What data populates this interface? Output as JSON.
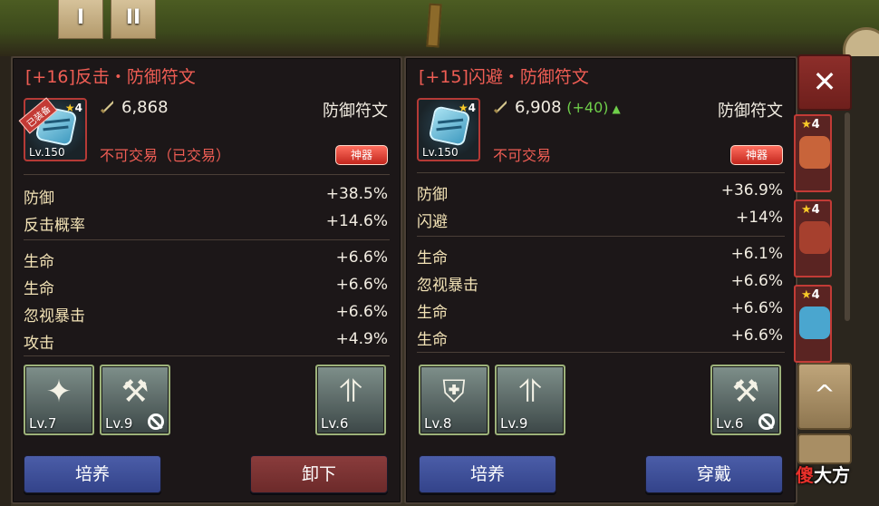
{
  "top_tabs": [
    "I",
    "II"
  ],
  "left": {
    "title": "[+16]反击・防御符文",
    "equipped_badge": "已装备",
    "stars": "4",
    "level": "Lv.150",
    "power": "6,868",
    "category": "防御符文",
    "trade_status": "不可交易（已交易）",
    "artifact_badge": "神器",
    "main_stats": [
      {
        "name": "防御",
        "value": "+38.5%"
      },
      {
        "name": "反击概率",
        "value": "+14.6%"
      }
    ],
    "sub_stats": [
      {
        "name": "生命",
        "value": "+6.6%"
      },
      {
        "name": "生命",
        "value": "+6.6%"
      },
      {
        "name": "忽视暴击",
        "value": "+6.6%"
      },
      {
        "name": "攻击",
        "value": "+4.9%"
      }
    ],
    "skills": [
      {
        "icon": "burst-icon",
        "level": "Lv.7"
      },
      {
        "icon": "hammer-locked-icon",
        "level": "Lv.9"
      },
      {
        "icon": "wings-up-icon",
        "level": "Lv.6"
      }
    ],
    "btn_train": "培养",
    "btn_action": "卸下"
  },
  "right": {
    "title": "[+15]闪避・防御符文",
    "stars": "4",
    "level": "Lv.150",
    "power": "6,908",
    "power_diff": "(+40)",
    "category": "防御符文",
    "trade_status": "不可交易",
    "artifact_badge": "神器",
    "main_stats": [
      {
        "name": "防御",
        "value": "+36.9%"
      },
      {
        "name": "闪避",
        "value": "+14%"
      }
    ],
    "sub_stats": [
      {
        "name": "生命",
        "value": "+6.1%"
      },
      {
        "name": "忽视暴击",
        "value": "+6.6%"
      },
      {
        "name": "生命",
        "value": "+6.6%"
      },
      {
        "name": "生命",
        "value": "+6.6%"
      }
    ],
    "skills": [
      {
        "icon": "shield-icon",
        "level": "Lv.8"
      },
      {
        "icon": "wings-up-icon",
        "level": "Lv.9"
      },
      {
        "icon": "hammer-locked-icon",
        "level": "Lv.6"
      }
    ],
    "btn_train": "培养",
    "btn_action": "穿戴"
  },
  "side_slots": [
    {
      "stars": "4",
      "color": "#c8643a"
    },
    {
      "stars": "4",
      "color": "#a6402e"
    },
    {
      "stars": "4",
      "color": "#4aa6cf"
    }
  ],
  "close_label": "✕",
  "scroll_label": "^",
  "watermark": {
    "red": "傻",
    "white": "大方"
  },
  "colors": {
    "title_red": "#ef5d54",
    "stat_label": "#f3e3b6",
    "diff_green": "#6fcf4a",
    "btn_blue": "#3f50a0",
    "btn_red": "#7a3232"
  }
}
